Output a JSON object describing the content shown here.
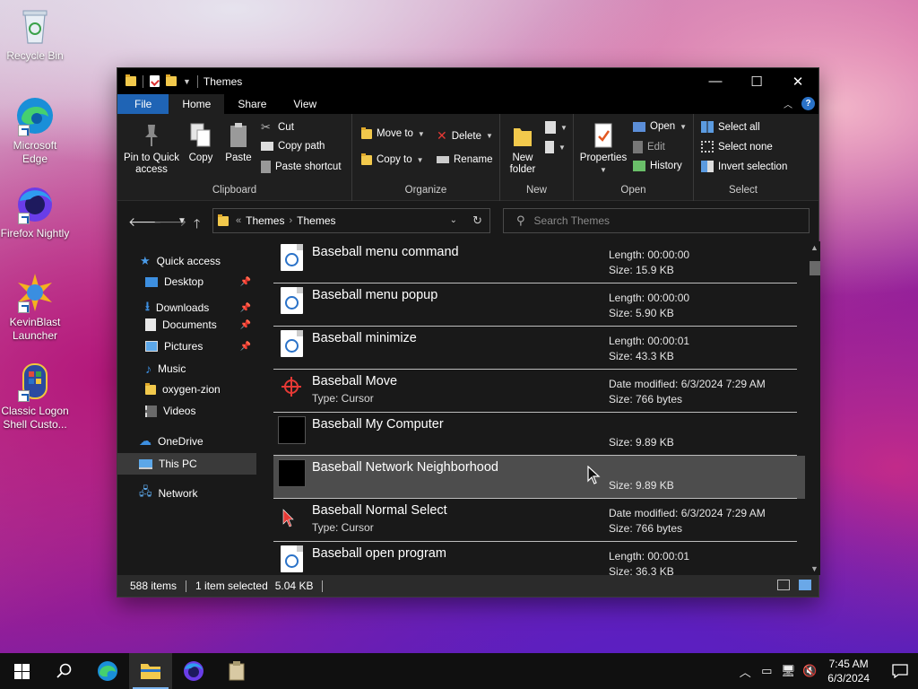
{
  "desktop": {
    "icons": [
      {
        "label": "Recycle Bin"
      },
      {
        "label": "Microsoft Edge"
      },
      {
        "label": "Firefox Nightly"
      },
      {
        "label": "KevinBlast Launcher"
      },
      {
        "label": "Classic Logon Shell Custo..."
      }
    ]
  },
  "window": {
    "title": "Themes",
    "controls": {
      "minimize": "—",
      "maximize": "☐",
      "close": "✕"
    }
  },
  "ribbon_tabs": [
    "File",
    "Home",
    "Share",
    "View"
  ],
  "ribbon": {
    "clipboard": {
      "label": "Clipboard",
      "pin": "Pin to Quick access",
      "copy": "Copy",
      "paste": "Paste",
      "cut": "Cut",
      "copy_path": "Copy path",
      "paste_shortcut": "Paste shortcut"
    },
    "organize": {
      "label": "Organize",
      "move_to": "Move to",
      "copy_to": "Copy to",
      "delete": "Delete",
      "rename": "Rename"
    },
    "new": {
      "label": "New",
      "new_folder": "New folder"
    },
    "open": {
      "label": "Open",
      "properties": "Properties",
      "open": "Open",
      "edit": "Edit",
      "history": "History"
    },
    "select": {
      "label": "Select",
      "select_all": "Select all",
      "select_none": "Select none",
      "invert": "Invert selection"
    }
  },
  "address": {
    "crumbs": [
      "Themes",
      "Themes"
    ],
    "search_placeholder": "Search Themes"
  },
  "nav": {
    "quick_access": "Quick access",
    "items": [
      {
        "label": "Desktop",
        "pinned": true
      },
      {
        "label": "Downloads",
        "pinned": true
      },
      {
        "label": "Documents",
        "pinned": true
      },
      {
        "label": "Pictures",
        "pinned": true
      },
      {
        "label": "Music",
        "pinned": false
      },
      {
        "label": "oxygen-zion",
        "pinned": false
      },
      {
        "label": "Videos",
        "pinned": false
      }
    ],
    "onedrive": "OneDrive",
    "this_pc": "This PC",
    "network": "Network"
  },
  "files": [
    {
      "name": "Baseball menu command",
      "type": "",
      "m1": "Length: 00:00:00",
      "m2": "Size: 15.9 KB",
      "thumb": "doc"
    },
    {
      "name": "Baseball menu popup",
      "type": "",
      "m1": "Length: 00:00:00",
      "m2": "Size: 5.90 KB",
      "thumb": "doc"
    },
    {
      "name": "Baseball minimize",
      "type": "",
      "m1": "Length: 00:00:01",
      "m2": "Size: 43.3 KB",
      "thumb": "doc"
    },
    {
      "name": "Baseball Move",
      "type": "Type: Cursor",
      "m1": "Date modified: 6/3/2024 7:29 AM",
      "m2": "Size: 766 bytes",
      "thumb": "move"
    },
    {
      "name": "Baseball My Computer",
      "type": "",
      "m1": "",
      "m2": "Size: 9.89 KB",
      "thumb": "black"
    },
    {
      "name": "Baseball Network Neighborhood",
      "type": "",
      "m1": "",
      "m2": "Size: 9.89 KB",
      "thumb": "black"
    },
    {
      "name": "Baseball Normal Select",
      "type": "Type: Cursor",
      "m1": "Date modified: 6/3/2024 7:29 AM",
      "m2": "Size: 766 bytes",
      "thumb": "arrow"
    },
    {
      "name": "Baseball open program",
      "type": "",
      "m1": "Length: 00:00:01",
      "m2": "Size: 36.3 KB",
      "thumb": "doc"
    }
  ],
  "status": {
    "items": "588 items",
    "selected": "1 item selected",
    "size": "5.04 KB"
  },
  "taskbar": {
    "time": "7:45 AM",
    "date": "6/3/2024"
  },
  "colors": {
    "accent": "#1f64b5",
    "window_bg": "#191919",
    "titlebar": "#000000",
    "hover_row": "#4d4d4d"
  }
}
